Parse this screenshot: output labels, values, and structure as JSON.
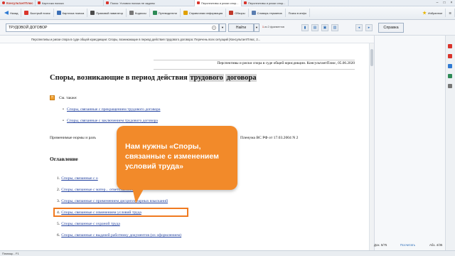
{
  "tabs": {
    "app": "КонсультантПлюс",
    "items": [
      {
        "label": "Карточка поиска"
      },
      {
        "label": "Поиск: Условия поиска не заданы"
      },
      {
        "label": "Перспективы и риски спор..."
      },
      {
        "label": "Перспективы и риски спор..."
      }
    ]
  },
  "toolbar": {
    "back": "Назад",
    "quick_search": "Быстрый поиск",
    "search_card": "Карточка поиска",
    "legal_navigator": "Правовой навигатор",
    "codes": "Кодексы",
    "guides": "Путеводители",
    "reference_info": "Справочная информация",
    "reviews": "Обзоры",
    "dictionary": "Словарь терминов",
    "search_history": "Поиск в инфо",
    "favorites": "Избранное"
  },
  "search": {
    "value": "ТРУДОВОЙ ДОГОВОР",
    "find_label": "Найти",
    "counter_num": "1",
    "counter_text": "из 2 фрагментов",
    "help_label": "Справка"
  },
  "doc_strip_title": "Перспективы и риски спора в суде общей юрисдикции: Споры, возникающие в период действия трудового договора: Перечень всех ситуаций (КонсультантПлюс, 2...",
  "document": {
    "source": "Перспективы и риски спора в суде общей юрисдикции. КонсультантПлюс, 05.06.2020",
    "title_part1": "Споры, возникающие в период действия",
    "title_hl1": "трудового",
    "title_hl2": "договора",
    "see_also": "См. также:",
    "see_also_links": [
      "Споры, связанные с прекращением трудового договора",
      "Споры, связанные с заключением трудового договора"
    ],
    "norms_start": "Применимые нормы и разъ",
    "norms_tail": "Пленума ВС РФ от 17.03.2004 N 2",
    "toc_heading": "Оглавление",
    "toc": [
      {
        "num": "1.",
        "text": "Споры, связанные с о"
      },
      {
        "num": "2.",
        "text": "Споры, связанные с матер... ответственностью"
      },
      {
        "num": "3.",
        "text": "Споры, связанные с применением дисциплинарных взысканий"
      },
      {
        "num": "4.",
        "text": "Споры, связанные с изменением условий труда"
      },
      {
        "num": "5.",
        "text": "Споры, связанные с охраной труда"
      },
      {
        "num": "6.",
        "text": "Споры, связанные с выдачей работнику документов (их оформлением)"
      }
    ]
  },
  "callout_text": "Нам нужны «Споры, связанные с изменением условий труда»",
  "status": {
    "help": "Помощь - F1",
    "doc_label": "Док. 5/75",
    "print_label": "Посчитать",
    "para_label": "Абз. 4/35"
  },
  "colors": {
    "accent": "#f28a2a",
    "link": "#1f3f9e",
    "brand": "#d9342b"
  }
}
